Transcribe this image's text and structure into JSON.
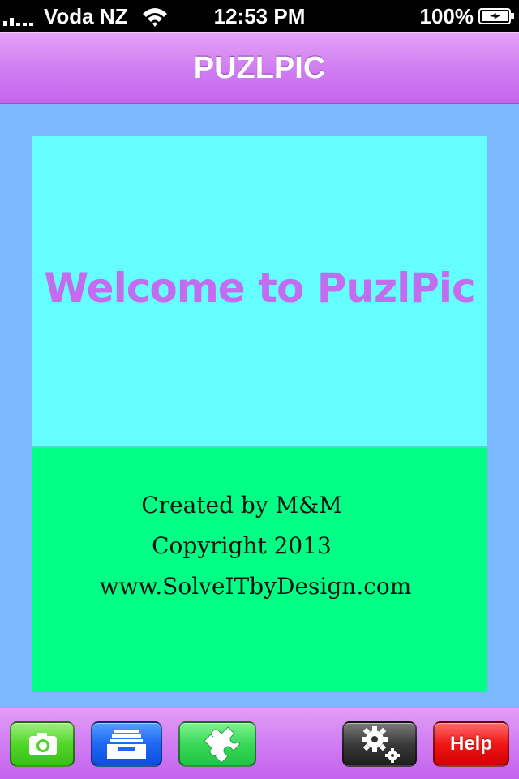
{
  "status_bar": {
    "carrier": "Voda NZ",
    "time": "12:53 PM",
    "battery": "100%"
  },
  "nav": {
    "title": "PUZLPIC"
  },
  "welcome": {
    "text": "Welcome to PuzlPic"
  },
  "credits": {
    "line1": "Created by M&M",
    "line2": "Copyright 2013",
    "line3": "www.SolveITbyDesign.com"
  },
  "toolbar": {
    "camera_icon": "camera-icon",
    "archive_icon": "archive-tray-icon",
    "puzzle_icon": "puzzle-piece-icon",
    "settings_icon": "gears-icon",
    "help_label": "Help"
  },
  "colors": {
    "nav_purple": "#d07ef2",
    "content_blue": "#7db7ff",
    "welcome_cyan": "#66ffff",
    "welcome_text": "#c46cf0",
    "credits_green": "#00ff84"
  }
}
